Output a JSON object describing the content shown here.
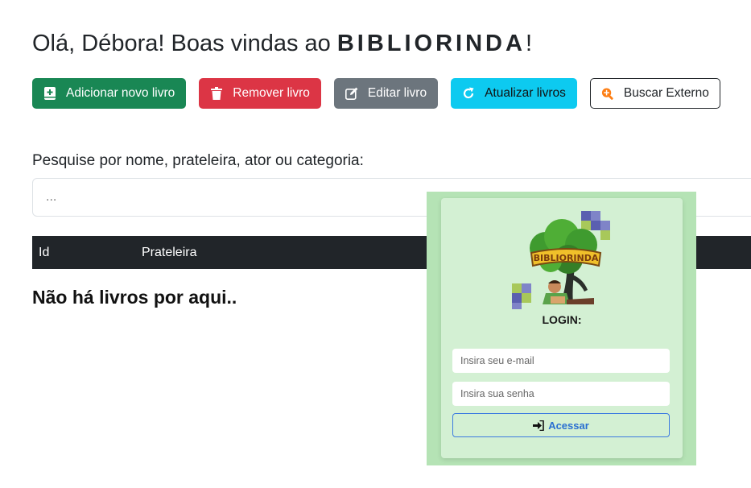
{
  "header": {
    "greeting": "Olá, Débora! Boas vindas ao ",
    "brand": "BIBLIORINDA",
    "suffix": "!"
  },
  "toolbar": {
    "add_label": "Adicionar novo livro",
    "remove_label": "Remover livro",
    "edit_label": "Editar livro",
    "refresh_label": "Atualizar livros",
    "external_label": "Buscar Externo"
  },
  "search": {
    "label": "Pesquise por nome, prateleira, ator ou categoria:",
    "placeholder": "..."
  },
  "table": {
    "columns": [
      "Id",
      "Prateleira"
    ]
  },
  "empty_message": "Não há livros por aqui..",
  "login": {
    "logo_text": "BIBLIORINDA",
    "title": "LOGIN:",
    "email_placeholder": "Insira seu e-mail",
    "password_placeholder": "Insira sua senha",
    "submit_label": "Acessar"
  },
  "colors": {
    "add": "#198754",
    "remove": "#dc3545",
    "edit": "#6c757d",
    "refresh": "#0dcaf0",
    "overlay_bg": "#b5e3b5",
    "card_bg": "#d3f0d3",
    "accent_blue": "#2a6fd1"
  }
}
